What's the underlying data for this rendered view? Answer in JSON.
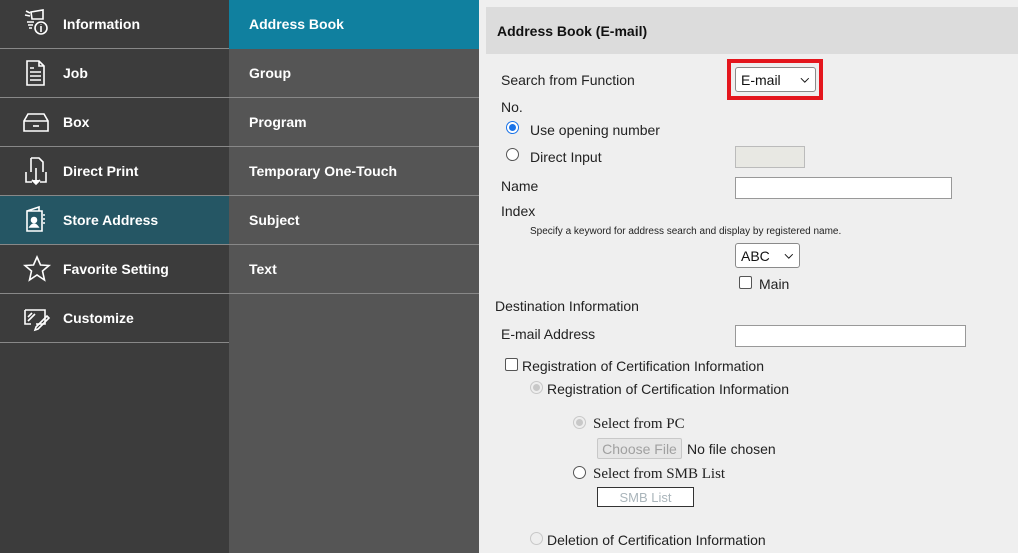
{
  "main_nav": {
    "items": [
      {
        "label": "Information",
        "icon": "information-icon",
        "active": false
      },
      {
        "label": "Job",
        "icon": "job-document-icon",
        "active": false
      },
      {
        "label": "Box",
        "icon": "box-tray-icon",
        "active": false
      },
      {
        "label": "Direct Print",
        "icon": "direct-print-icon",
        "active": false
      },
      {
        "label": "Store Address",
        "icon": "address-book-icon",
        "active": true
      },
      {
        "label": "Favorite Setting",
        "icon": "star-icon",
        "active": false
      },
      {
        "label": "Customize",
        "icon": "customize-icon",
        "active": false
      }
    ]
  },
  "sub_nav": {
    "items": [
      {
        "label": "Address Book",
        "active": true
      },
      {
        "label": "Group",
        "active": false
      },
      {
        "label": "Program",
        "active": false
      },
      {
        "label": "Temporary One-Touch",
        "active": false
      },
      {
        "label": "Subject",
        "active": false
      },
      {
        "label": "Text",
        "active": false
      }
    ]
  },
  "form": {
    "title": "Address Book (E-mail)",
    "search_from_function": {
      "label": "Search from Function",
      "value": "E-mail"
    },
    "no": {
      "label": "No.",
      "use_opening_number": {
        "label": "Use opening number",
        "checked": true
      },
      "direct_input": {
        "label": "Direct Input",
        "checked": false,
        "value": ""
      }
    },
    "name": {
      "label": "Name",
      "value": ""
    },
    "index": {
      "label": "Index",
      "hint": "Specify a keyword for address search and display by registered name.",
      "value": "ABC",
      "main": {
        "label": "Main",
        "checked": false
      }
    },
    "destination": {
      "label": "Destination Information",
      "email": {
        "label": "E-mail Address",
        "value": ""
      }
    },
    "certification": {
      "checkbox_label": "Registration of Certification Information",
      "checked": false,
      "registration_label": "Registration of Certification Information",
      "select_from_pc": "Select from PC",
      "choose_file": "Choose File",
      "no_file": "No file chosen",
      "select_from_smb": "Select from SMB List",
      "smb_list_button": "SMB List",
      "deletion_label": "Deletion of Certification Information"
    }
  },
  "highlight_color": "#e4161d"
}
